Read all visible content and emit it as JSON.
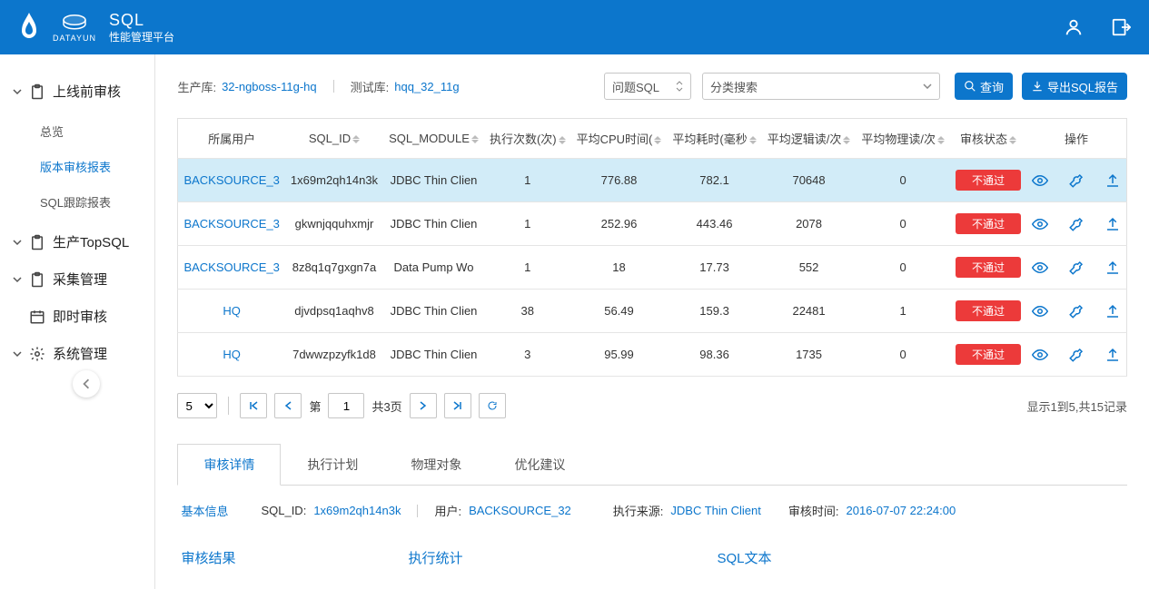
{
  "header": {
    "title_line1": "SQL",
    "title_line2": "性能管理平台",
    "logo_text": "DATAYUN"
  },
  "sidebar": {
    "groups": [
      {
        "label": "上线前审核",
        "items": [
          {
            "label": "总览",
            "active": false
          },
          {
            "label": "版本审核报表",
            "active": true
          },
          {
            "label": "SQL跟踪报表",
            "active": false
          }
        ]
      },
      {
        "label": "生产TopSQL"
      },
      {
        "label": "采集管理"
      },
      {
        "label": "即时审核"
      },
      {
        "label": "系统管理"
      }
    ]
  },
  "filters": {
    "prod_label": "生产库:",
    "prod_value": "32-ngboss-11g-hq",
    "test_label": "测试库:",
    "test_value": "hqq_32_11g",
    "select1": "问题SQL",
    "select2": "分类搜索",
    "btn_query": "查询",
    "btn_export": "导出SQL报告"
  },
  "table": {
    "headers": [
      "所属用户",
      "SQL_ID",
      "SQL_MODULE",
      "执行次数(次)",
      "平均CPU时间(",
      "平均耗时(毫秒",
      "平均逻辑读/次",
      "平均物理读/次",
      "审核状态",
      "操作"
    ],
    "rows": [
      {
        "user": "BACKSOURCE_3",
        "sqlid": "1x69m2qh14n3k",
        "module": "JDBC Thin Clien",
        "exec": "1",
        "cpu": "776.88",
        "elapsed": "782.1",
        "lreads": "70648",
        "preads": "0",
        "status": "不通过",
        "selected": true
      },
      {
        "user": "BACKSOURCE_3",
        "sqlid": "gkwnjqquhxmjr",
        "module": "JDBC Thin Clien",
        "exec": "1",
        "cpu": "252.96",
        "elapsed": "443.46",
        "lreads": "2078",
        "preads": "0",
        "status": "不通过",
        "selected": false
      },
      {
        "user": "BACKSOURCE_3",
        "sqlid": "8z8q1q7gxgn7a",
        "module": "Data Pump Wo",
        "exec": "1",
        "cpu": "18",
        "elapsed": "17.73",
        "lreads": "552",
        "preads": "0",
        "status": "不通过",
        "selected": false
      },
      {
        "user": "HQ",
        "sqlid": "djvdpsq1aqhv8",
        "module": "JDBC Thin Clien",
        "exec": "38",
        "cpu": "56.49",
        "elapsed": "159.3",
        "lreads": "22481",
        "preads": "1",
        "status": "不通过",
        "selected": false
      },
      {
        "user": "HQ",
        "sqlid": "7dwwzpzyfk1d8",
        "module": "JDBC Thin Clien",
        "exec": "3",
        "cpu": "95.99",
        "elapsed": "98.36",
        "lreads": "1735",
        "preads": "0",
        "status": "不通过",
        "selected": false
      }
    ]
  },
  "pagination": {
    "page_size": "5",
    "page_label": "第",
    "current": "1",
    "total_pages": "共3页",
    "range_info": "显示1到5,共15记录"
  },
  "tabs": [
    "审核详情",
    "执行计划",
    "物理对象",
    "优化建议"
  ],
  "detail": {
    "basic_info": "基本信息",
    "sqlid_label": "SQL_ID:",
    "sqlid_value": "1x69m2qh14n3k",
    "user_label": "用户:",
    "user_value": "BACKSOURCE_32",
    "source_label": "执行来源:",
    "source_value": "JDBC Thin Client",
    "time_label": "审核时间:",
    "time_value": "2016-07-07 22:24:00",
    "col1": "审核结果",
    "col2": "执行统计",
    "col3": "SQL文本"
  }
}
